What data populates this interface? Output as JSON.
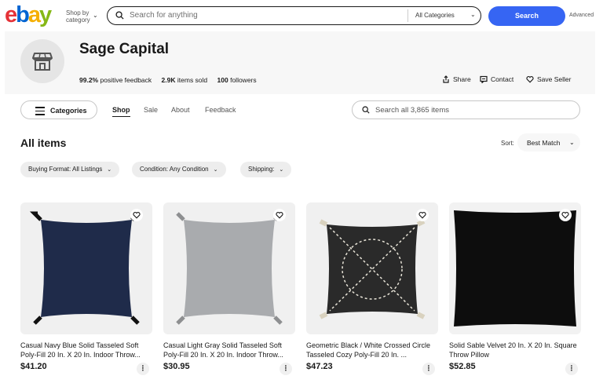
{
  "header": {
    "logo": [
      "e",
      "b",
      "a",
      "y"
    ],
    "shop_by": [
      "Shop by",
      "category"
    ],
    "search_placeholder": "Search for anything",
    "category_select": "All Categories",
    "search_button": "Search",
    "advanced": "Advanced"
  },
  "store": {
    "name": "Sage Capital",
    "feedback_value": "99.2%",
    "feedback_label": "positive feedback",
    "sold_value": "2.9K",
    "sold_label": "items sold",
    "followers_value": "100",
    "followers_label": "followers",
    "actions": {
      "share": "Share",
      "contact": "Contact",
      "save": "Save Seller"
    }
  },
  "nav": {
    "categories": "Categories",
    "tabs": [
      "Shop",
      "Sale",
      "About",
      "Feedback"
    ],
    "active_tab": "Shop",
    "store_search_placeholder": "Search all 3,865 items"
  },
  "listing": {
    "heading": "All items",
    "sort_label": "Sort:",
    "sort_value": "Best Match",
    "filters": [
      "Buying Format: All Listings",
      "Condition: Any Condition",
      "Shipping:"
    ]
  },
  "products": [
    {
      "title": "Casual Navy Blue Solid Tasseled Soft Poly-Fill 20 In. X 20 In. Indoor Throw...",
      "price": "$41.20",
      "color": "#1f2b4a"
    },
    {
      "title": "Casual Light Gray Solid Tasseled Soft Poly-Fill 20 In. X 20 In. Indoor Throw...",
      "price": "$30.95",
      "color": "#a9abae"
    },
    {
      "title": "Geometric Black / White Crossed Circle Tasseled Cozy Poly-Fill 20 In. ...",
      "price": "$47.23",
      "color": "#2a2a2a"
    },
    {
      "title": "Solid Sable Velvet 20 In. X 20 In. Square Throw Pillow",
      "price": "$52.85",
      "color": "#0d0d0d"
    }
  ]
}
